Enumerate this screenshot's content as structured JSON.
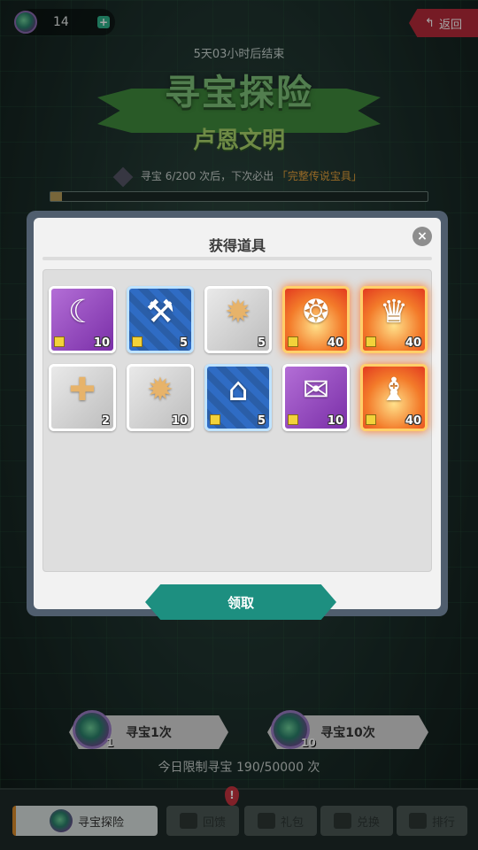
{
  "topbar": {
    "currency_value": "14",
    "currency_icon": "planet-coin-icon",
    "plus_label": "+",
    "back_label": "返回"
  },
  "event": {
    "countdown": "5天03小时后结束",
    "title": "寻宝探险",
    "subtitle": "卢恩文明",
    "progress_prefix": "寻宝 6/200 次后，下次必出",
    "progress_highlight": "「完整传说宝具」",
    "progress_fraction": 0.03
  },
  "modal": {
    "title": "获得道具",
    "close_label": "×",
    "claim_label": "领取",
    "items": [
      {
        "rarity": "purple",
        "icon": "crescent-blade-icon",
        "glyph": "☾",
        "count": "10",
        "badge": true
      },
      {
        "rarity": "blue",
        "icon": "mace-icon",
        "glyph": "⚒",
        "count": "5",
        "badge": true
      },
      {
        "rarity": "gray",
        "icon": "sun-emblem-icon",
        "glyph": "✹",
        "count": "5",
        "badge": false
      },
      {
        "rarity": "orange",
        "icon": "flaming-relic-icon",
        "glyph": "❂",
        "count": "40",
        "badge": true
      },
      {
        "rarity": "orange",
        "icon": "flaming-crown-icon",
        "glyph": "♛",
        "count": "40",
        "badge": true
      },
      {
        "rarity": "gray",
        "icon": "gold-cross-block-icon",
        "glyph": "✚",
        "count": "2",
        "badge": false
      },
      {
        "rarity": "gray",
        "icon": "sun-emblem-icon",
        "glyph": "✹",
        "count": "10",
        "badge": false
      },
      {
        "rarity": "blue",
        "icon": "striped-tent-icon",
        "glyph": "⌂",
        "count": "5",
        "badge": true
      },
      {
        "rarity": "purple",
        "icon": "spell-book-icon",
        "glyph": "✉",
        "count": "10",
        "badge": true
      },
      {
        "rarity": "orange",
        "icon": "flaming-chess-piece-icon",
        "glyph": "♝",
        "count": "40",
        "badge": true
      }
    ]
  },
  "draw": {
    "single_label": "寻宝1次",
    "single_cost": "1",
    "ten_label": "寻宝10次",
    "ten_cost": "10",
    "limit_text": "今日限制寻宝 190/50000 次"
  },
  "nav": {
    "items": [
      {
        "label": "寻宝探险",
        "icon": "planet-coin-icon",
        "active": true
      },
      {
        "label": "回馈",
        "icon": "reward-icon",
        "active": false
      },
      {
        "label": "礼包",
        "icon": "gift-icon",
        "active": false
      },
      {
        "label": "兑换",
        "icon": "exchange-icon",
        "active": false
      },
      {
        "label": "排行",
        "icon": "ranking-icon",
        "active": false
      }
    ],
    "alert": "!"
  }
}
